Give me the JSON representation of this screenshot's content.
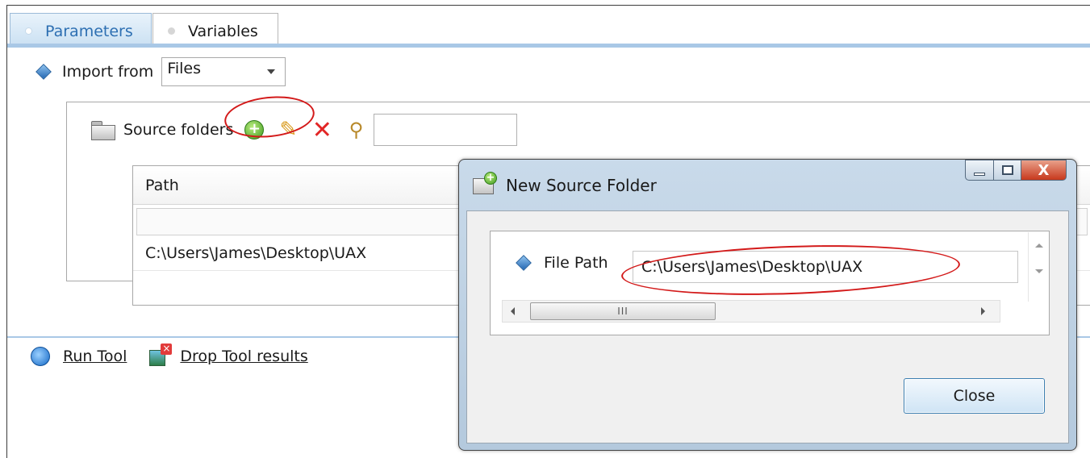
{
  "tabs": [
    {
      "label": "Parameters",
      "active": true
    },
    {
      "label": "Variables",
      "active": false
    }
  ],
  "import": {
    "label": "Import from",
    "value": "Files"
  },
  "source_folders": {
    "label": "Source folders",
    "filter_value": "",
    "icons": [
      "add-icon",
      "edit-pencil-icon",
      "delete-icon",
      "find-key-icon"
    ]
  },
  "path_table": {
    "header": "Path",
    "rows": [
      "C:\\Users\\James\\Desktop\\UAX"
    ]
  },
  "actions": {
    "run": "Run Tool",
    "drop": "Drop Tool results"
  },
  "dialog": {
    "title": "New Source Folder",
    "field_label": "File Path",
    "field_value": "C:\\Users\\James\\Desktop\\UAX",
    "scroll_grip": "III",
    "close_button": "Close",
    "close_glyph": "X"
  },
  "colors": {
    "accent": "#2d6fb2",
    "annotation": "#d31a1a",
    "delete": "#e22626"
  }
}
